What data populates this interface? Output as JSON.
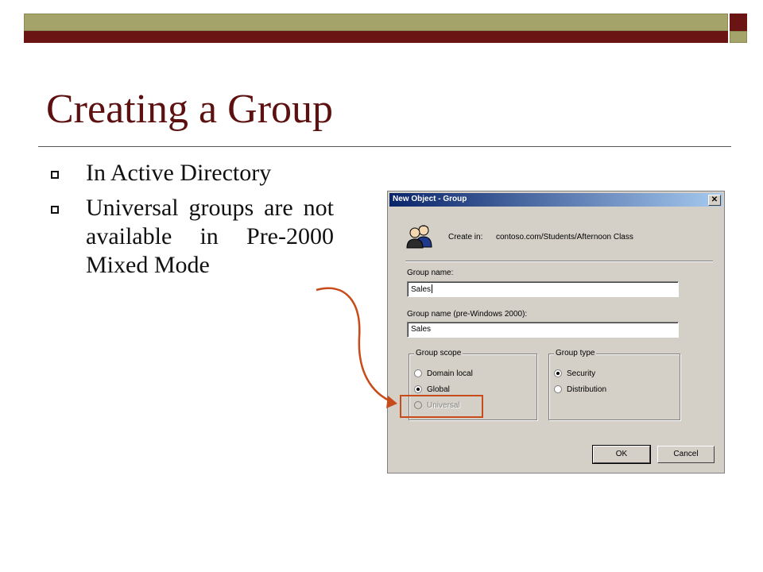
{
  "slide": {
    "title": "Creating a Group",
    "bullets": [
      "In Active Directory",
      "Universal groups are not available in Pre-2000 Mixed Mode"
    ]
  },
  "colors": {
    "title": "#5c1010",
    "band_olive": "#a4a46a",
    "band_maroon": "#6b1414",
    "annotation": "#c84b1a",
    "titlebar_start": "#0a246a",
    "dialog_face": "#d4d0c8"
  },
  "dialog": {
    "title": "New Object - Group",
    "close_glyph": "✕",
    "icon": "group-users-icon",
    "create_in_label": "Create in:",
    "create_in_value": "contoso.com/Students/Afternoon Class",
    "group_name_label": "Group name:",
    "group_name_value": "Sales",
    "pre2000_label": "Group name (pre-Windows 2000):",
    "pre2000_value": "Sales",
    "scope": {
      "title": "Group scope",
      "options": [
        {
          "label": "Domain local",
          "checked": false,
          "disabled": false
        },
        {
          "label": "Global",
          "checked": true,
          "disabled": false
        },
        {
          "label": "Universal",
          "checked": false,
          "disabled": true
        }
      ]
    },
    "type": {
      "title": "Group type",
      "options": [
        {
          "label": "Security",
          "checked": true
        },
        {
          "label": "Distribution",
          "checked": false
        }
      ]
    },
    "ok_label": "OK",
    "cancel_label": "Cancel"
  }
}
